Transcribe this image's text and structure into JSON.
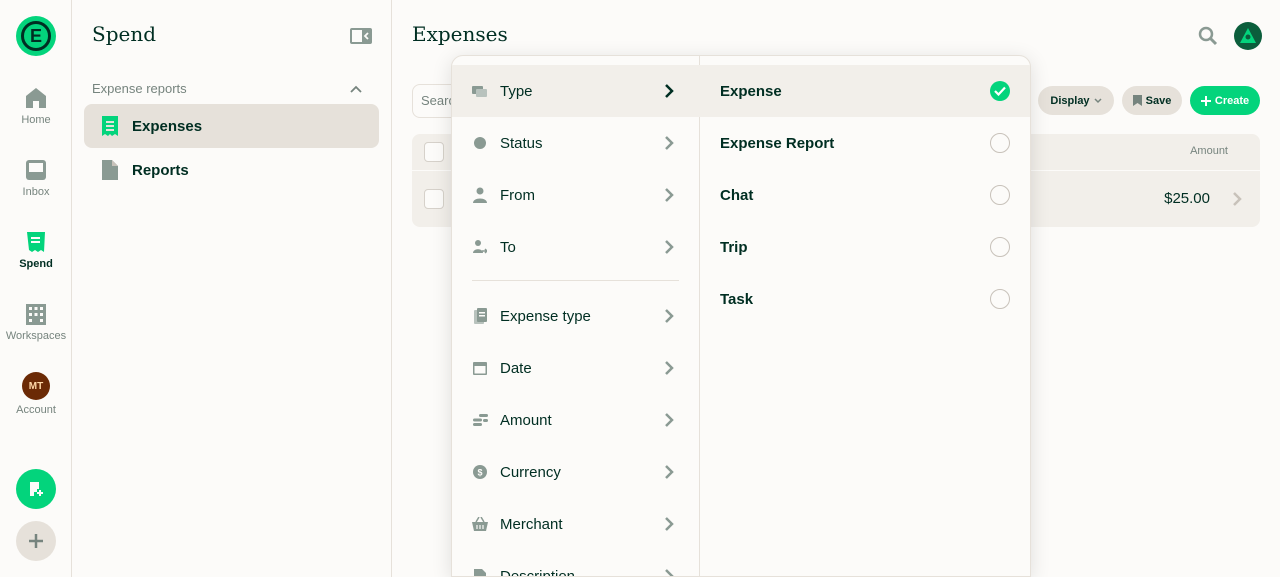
{
  "rail": {
    "items": [
      {
        "label": "Home",
        "icon": "home-icon"
      },
      {
        "label": "Inbox",
        "icon": "inbox-icon"
      },
      {
        "label": "Spend",
        "icon": "receipt-icon"
      },
      {
        "label": "Workspaces",
        "icon": "building-icon"
      },
      {
        "label": "Account",
        "icon": "avatar"
      }
    ],
    "account_initials": "MT"
  },
  "sidebar": {
    "title": "Spend",
    "section_label": "Expense reports",
    "items": [
      {
        "label": "Expenses"
      },
      {
        "label": "Reports"
      }
    ]
  },
  "main": {
    "title": "Expenses",
    "search_placeholder": "Search",
    "display_label": "Display",
    "save_label": "Save",
    "create_label": "Create",
    "amount_header": "Amount",
    "row_amount": "$25.00"
  },
  "filters": {
    "items": [
      {
        "label": "Type",
        "icon": "type-icon"
      },
      {
        "label": "Status",
        "icon": "status-icon"
      },
      {
        "label": "From",
        "icon": "person-icon"
      },
      {
        "label": "To",
        "icon": "person-to-icon"
      },
      {
        "label": "Expense type",
        "icon": "receipt-icon"
      },
      {
        "label": "Date",
        "icon": "calendar-icon"
      },
      {
        "label": "Amount",
        "icon": "coins-icon"
      },
      {
        "label": "Currency",
        "icon": "currency-icon"
      },
      {
        "label": "Merchant",
        "icon": "basket-icon"
      },
      {
        "label": "Description",
        "icon": "document-icon"
      }
    ]
  },
  "type_options": {
    "items": [
      {
        "label": "Expense",
        "selected": true
      },
      {
        "label": "Expense Report",
        "selected": false
      },
      {
        "label": "Chat",
        "selected": false
      },
      {
        "label": "Trip",
        "selected": false
      },
      {
        "label": "Task",
        "selected": false
      }
    ]
  },
  "colors": {
    "accent": "#03d47c",
    "text": "#002e22",
    "muted": "#76847e",
    "border": "#e6e1da",
    "active_bg": "#e6e1da"
  }
}
